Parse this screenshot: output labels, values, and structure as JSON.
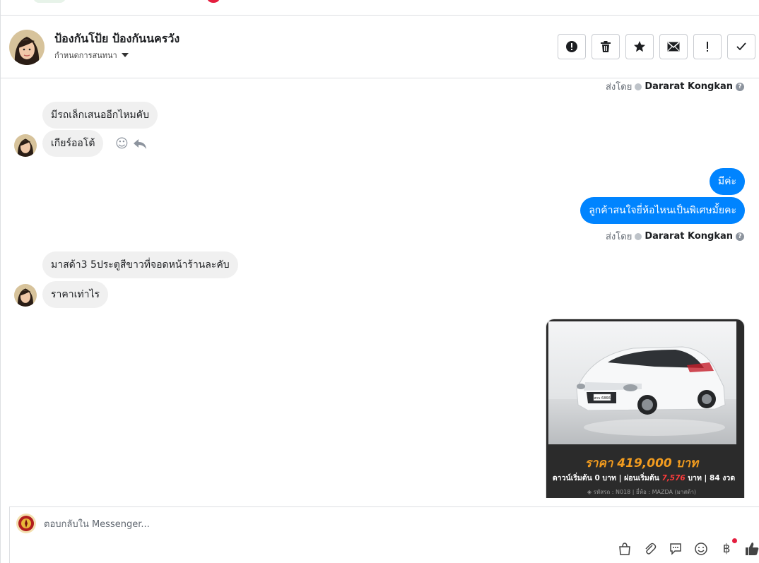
{
  "header": {
    "name": "ป้องกันโป้ย ป้องกันนครวัง",
    "subtitle": "กำหนดการสนทนา",
    "toolbar": [
      "spam",
      "delete",
      "star",
      "mark-unread",
      "important",
      "done"
    ]
  },
  "thread": {
    "sent_by_label": "ส่งโดย",
    "sent_by_name": "Dararat Kongkan",
    "messages": [
      {
        "dir": "in",
        "text": "มีรถเล็กเสนออีกไหมคับ"
      },
      {
        "dir": "in",
        "text": "เกียร์ออโต้"
      },
      {
        "dir": "out",
        "text": "มีค่ะ"
      },
      {
        "dir": "out",
        "text": "ลูกค้าสนใจยี่ห้อไหนเป็นพิเศษมั้ยคะ"
      },
      {
        "dir": "in",
        "text": "มาสด้า3 5ประตูสีขาวที่จอดหน้าร้านละคับ"
      },
      {
        "dir": "in",
        "text": "ราคาเท่าไร"
      }
    ],
    "car_card": {
      "price_text": "ราคา 419,000 บาท",
      "down_label": "ดาวน์เริ่มต้น",
      "down_value": "0",
      "unit": "บาท",
      "installment_label": "ผ่อนเริ่มต้น",
      "installment_value": "7,576",
      "months": "84 งวด",
      "meta": "รหัสรถ : N018 | ยี่ห้อ : MAZDA (มาสด้า)",
      "plate": "สกบ 6866"
    }
  },
  "composer": {
    "placeholder": "ตอบกลับใน Messenger..."
  },
  "colors": {
    "outgoing": "#0084ff",
    "incoming": "#f0f0f0",
    "price": "#f29c1f",
    "installment": "#ff3b3b"
  }
}
